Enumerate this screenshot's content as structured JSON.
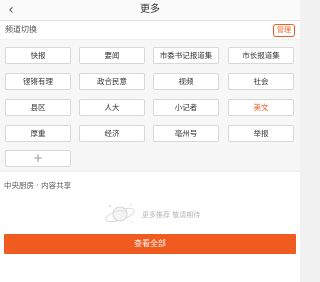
{
  "header": {
    "title": "更多",
    "back_glyph": "‹"
  },
  "channels": {
    "section_label": "频道切换",
    "manage_label": "管理",
    "add_glyph": "+",
    "tags": [
      {
        "label": "快报",
        "active": false
      },
      {
        "label": "要闻",
        "active": false
      },
      {
        "label": "市委书记报道集",
        "active": false
      },
      {
        "label": "市长报道集",
        "active": false
      },
      {
        "label": "铿锵有理",
        "active": false
      },
      {
        "label": "政合民意",
        "active": false
      },
      {
        "label": "视频",
        "active": false
      },
      {
        "label": "社会",
        "active": false
      },
      {
        "label": "县区",
        "active": false
      },
      {
        "label": "人大",
        "active": false
      },
      {
        "label": "小记者",
        "active": false
      },
      {
        "label": "美文",
        "active": true
      },
      {
        "label": "厚重",
        "active": false
      },
      {
        "label": "经济",
        "active": false
      },
      {
        "label": "亳州号",
        "active": false
      },
      {
        "label": "举报",
        "active": false
      }
    ]
  },
  "content": {
    "section_title": "中央厨房 · 内容共享",
    "empty_message": "更多推荐 敬请期待",
    "view_all_label": "查看全部"
  },
  "colors": {
    "accent": "#f05b1f",
    "active_tag": "#f05b1f"
  }
}
